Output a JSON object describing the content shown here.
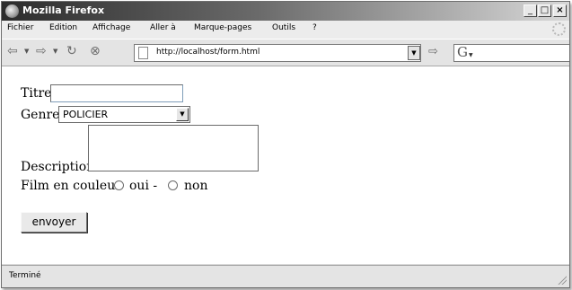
{
  "window": {
    "title": "Mozilla Firefox",
    "controls": {
      "minimize": "_",
      "maximize": "□",
      "close": "×"
    }
  },
  "menu": {
    "items": [
      "Fichier",
      "Edition",
      "Affichage",
      "Aller à",
      "Marque-pages",
      "Outils",
      "?"
    ]
  },
  "toolbar": {
    "url": "http://localhost/form.html",
    "icons": [
      "back-icon",
      "forward-icon",
      "reload-icon",
      "stop-icon",
      "page-icon",
      "go-icon",
      "search-engine-icon"
    ]
  },
  "form": {
    "titre_label": "Titre",
    "titre_value": "",
    "genre_label": "Genre",
    "genre_selected": "POLICIER",
    "description_label": "Description",
    "description_value": "",
    "couleur_label": "Film en couleur",
    "oui_label": "oui -",
    "non_label": "non",
    "submit_label": "envoyer"
  },
  "status": {
    "text": "Terminé"
  }
}
